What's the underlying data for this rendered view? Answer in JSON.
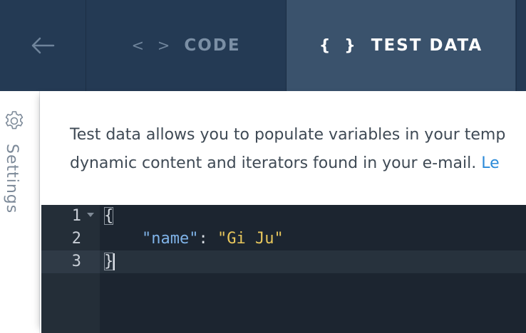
{
  "header": {
    "back_icon": "arrow-left-icon",
    "tabs": [
      {
        "icon_glyph": "< >",
        "icon_name": "code-brackets-icon",
        "label": "CODE",
        "active": false
      },
      {
        "icon_glyph": "{ }",
        "icon_name": "curly-braces-icon",
        "label": "TEST DATA",
        "active": true
      }
    ]
  },
  "sidebar": {
    "icon_name": "gear-icon",
    "label": "Settings"
  },
  "description": {
    "line1": "Test data allows you to populate variables in your temp",
    "line2_text": "dynamic content and iterators found in your e-mail. ",
    "line2_link": "Le"
  },
  "editor": {
    "lines": [
      {
        "number": "1",
        "parts": {
          "open": "{"
        }
      },
      {
        "number": "2",
        "parts": {
          "indent": "    ",
          "key": "\"name\"",
          "colon": ": ",
          "value": "\"Gi Ju\""
        }
      },
      {
        "number": "3",
        "parts": {
          "close": "}"
        }
      }
    ]
  },
  "colors": {
    "header_bg": "#243a54",
    "active_tab_bg": "#3a526c",
    "editor_bg": "#1c2530",
    "link": "#2b8ad8",
    "json_key": "#7fb3e8",
    "json_string": "#e8c75c"
  }
}
